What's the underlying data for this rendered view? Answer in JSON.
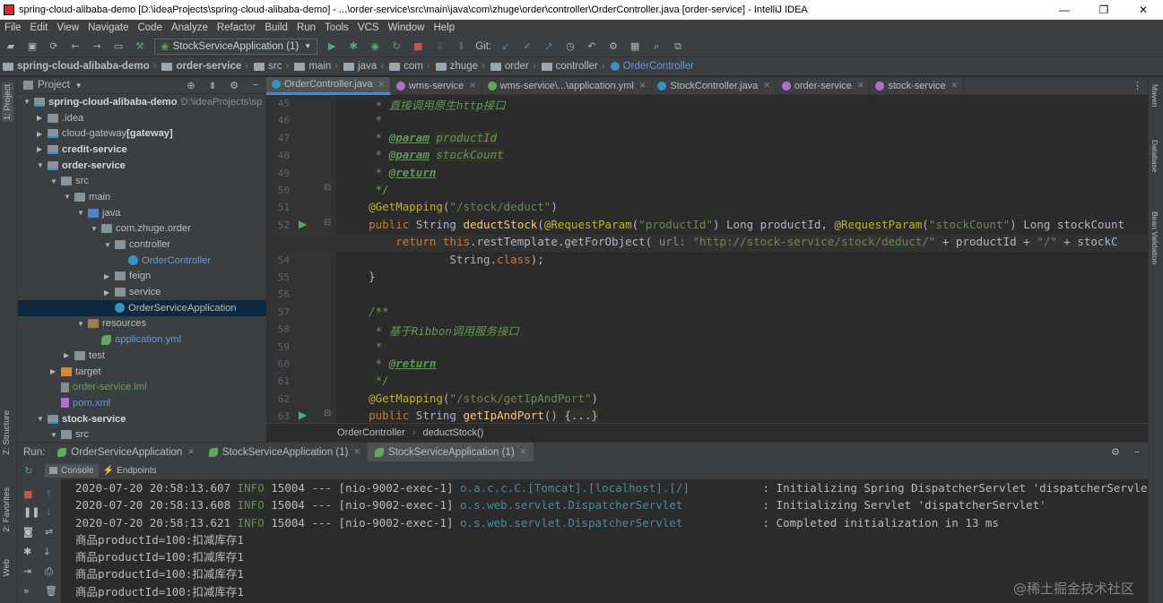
{
  "window": {
    "title": "spring-cloud-alibaba-demo [D:\\ideaProjects\\spring-cloud-alibaba-demo] - ...\\order-service\\src\\main\\java\\com\\zhuge\\order\\controller\\OrderController.java [order-service] - IntelliJ IDEA",
    "min": "—",
    "max": "❐",
    "close": "✕"
  },
  "menu": [
    "File",
    "Edit",
    "View",
    "Navigate",
    "Code",
    "Analyze",
    "Refactor",
    "Build",
    "Run",
    "Tools",
    "VCS",
    "Window",
    "Help"
  ],
  "toolbar": {
    "run_config": "StockServiceApplication (1)",
    "git_label": "Git:"
  },
  "breadcrumb": [
    "spring-cloud-alibaba-demo",
    "order-service",
    "src",
    "main",
    "java",
    "com",
    "zhuge",
    "order",
    "controller",
    "OrderController"
  ],
  "project": {
    "header": "Project",
    "tree": [
      {
        "depth": 0,
        "arrow": "▼",
        "icon": "mod",
        "text": "spring-cloud-alibaba-demo",
        "hint": "D:\\ideaProjects\\sp",
        "bold": true
      },
      {
        "depth": 1,
        "arrow": "▶",
        "icon": "fold",
        "text": ".idea"
      },
      {
        "depth": 1,
        "arrow": "▶",
        "icon": "mod",
        "text": "cloud-gateway",
        "extra": " [gateway]"
      },
      {
        "depth": 1,
        "arrow": "▶",
        "icon": "mod",
        "text": "credit-service",
        "bold": true
      },
      {
        "depth": 1,
        "arrow": "▼",
        "icon": "mod",
        "text": "order-service",
        "bold": true
      },
      {
        "depth": 2,
        "arrow": "▼",
        "icon": "fold",
        "text": "src"
      },
      {
        "depth": 3,
        "arrow": "▼",
        "icon": "fold",
        "text": "main"
      },
      {
        "depth": 4,
        "arrow": "▼",
        "icon": "src",
        "text": "java"
      },
      {
        "depth": 5,
        "arrow": "▼",
        "icon": "fold",
        "text": "com.zhuge.order"
      },
      {
        "depth": 6,
        "arrow": "▼",
        "icon": "fold",
        "text": "controller"
      },
      {
        "depth": 7,
        "arrow": "",
        "icon": "cls",
        "text": "OrderController",
        "color": "blue"
      },
      {
        "depth": 6,
        "arrow": "▶",
        "icon": "fold",
        "text": "feign"
      },
      {
        "depth": 6,
        "arrow": "▶",
        "icon": "fold",
        "text": "service"
      },
      {
        "depth": 6,
        "arrow": "",
        "icon": "cls",
        "text": "OrderServiceApplication",
        "selected": true
      },
      {
        "depth": 4,
        "arrow": "▼",
        "icon": "res",
        "text": "resources"
      },
      {
        "depth": 5,
        "arrow": "",
        "icon": "spring",
        "text": "application.yml",
        "color": "blue"
      },
      {
        "depth": 3,
        "arrow": "▶",
        "icon": "fold",
        "text": "test"
      },
      {
        "depth": 2,
        "arrow": "▶",
        "icon": "excl",
        "text": "target"
      },
      {
        "depth": 2,
        "arrow": "",
        "icon": "file",
        "text": "order-service.iml",
        "color": "green"
      },
      {
        "depth": 2,
        "arrow": "",
        "icon": "mvn",
        "text": "pom.xml",
        "color": "blue"
      },
      {
        "depth": 1,
        "arrow": "▼",
        "icon": "mod",
        "text": "stock-service",
        "bold": true
      },
      {
        "depth": 2,
        "arrow": "▼",
        "icon": "fold",
        "text": "src"
      }
    ]
  },
  "editor_tabs": [
    {
      "label": "OrderController.java",
      "active": true,
      "color": "#3592c4"
    },
    {
      "label": "wms-service",
      "color": "#b26fd0"
    },
    {
      "label": "wms-service\\...\\application.yml",
      "color": "#5fa85f"
    },
    {
      "label": "StockController.java",
      "color": "#3592c4"
    },
    {
      "label": "order-service",
      "color": "#b26fd0"
    },
    {
      "label": "stock-service",
      "color": "#b26fd0"
    }
  ],
  "code_lines": [
    {
      "n": "45",
      "html": "     <span class='cmt'>* 直接调用原生http接口</span>"
    },
    {
      "n": "46",
      "html": "     <span class='cmt'>*</span>"
    },
    {
      "n": "47",
      "html": "     <span class='cmt'>* </span><span class='tag'>@param</span><span class='cmt'> </span><span class='hl cmt'>productId</span>"
    },
    {
      "n": "48",
      "html": "     <span class='cmt'>* </span><span class='tag'>@param</span><span class='cmt'> </span><span class='hl cmt'>stockCount</span>"
    },
    {
      "n": "49",
      "html": "     <span class='cmt'>* </span><span class='tag'>@return</span>"
    },
    {
      "n": "50",
      "html": "     <span class='cmt'>*/</span>"
    },
    {
      "n": "51",
      "html": "    <span class='ann'>@GetMapping</span>(<span class='str'>\"/stock/deduct\"</span>)"
    },
    {
      "n": "52",
      "html": "    <span class='kw'>public</span> String <span class='fn'>deductStock</span>(<span class='ann'>@RequestParam</span>(<span class='str'>\"productId\"</span>) Long productId, <span class='ann'>@RequestParam</span>(<span class='str'>\"stockCount\"</span>) Long stockCount"
    },
    {
      "n": "53",
      "html": "        <span class='kw'>return this</span>.restTemplate.getForObject( <span class='param'>url:</span> <span class='str'>\"http://stock-service/stock/deduct/\"</span> + productId + <span class='str'>\"/\"</span> + stockC"
    },
    {
      "n": "54",
      "html": "                String.<span class='kw'>class</span>);"
    },
    {
      "n": "55",
      "html": "    }"
    },
    {
      "n": "56",
      "html": ""
    },
    {
      "n": "57",
      "html": "    <span class='cmt'>/**</span>"
    },
    {
      "n": "58",
      "html": "     <span class='cmt'>* 基于Ribbon调用服务接口</span>"
    },
    {
      "n": "59",
      "html": "     <span class='cmt'>*</span>"
    },
    {
      "n": "60",
      "html": "     <span class='cmt'>* </span><span class='tag'>@return</span>"
    },
    {
      "n": "61",
      "html": "     <span class='cmt'>*/</span>"
    },
    {
      "n": "62",
      "html": "    <span class='ann'>@GetMapping</span>(<span class='str'>\"/stock/getIpAndPort\"</span>)"
    },
    {
      "n": "63",
      "html": "    <span class='kw'>public</span> String <span class='fn'>getIpAndPort</span>() <span class='hl'>{...}</span>"
    }
  ],
  "editor_breadcrumb": [
    "OrderController",
    "deductStock()"
  ],
  "run": {
    "label": "Run:",
    "tabs": [
      "OrderServiceApplication",
      "StockServiceApplication (1)",
      "StockServiceApplication (1)"
    ],
    "subtabs": [
      "Console",
      "Endpoints"
    ],
    "console": [
      {
        "ts": "2020-07-20 20:58:13.607",
        "lvl": "INFO",
        "pid": "15004",
        "sep": "---",
        "thread": "[nio-9002-exec-1]",
        "logger": "o.a.c.c.C.[Tomcat].[localhost].[/]",
        "msg": ": Initializing Spring DispatcherServlet 'dispatcherServlet'"
      },
      {
        "ts": "2020-07-20 20:58:13.608",
        "lvl": "INFO",
        "pid": "15004",
        "sep": "---",
        "thread": "[nio-9002-exec-1]",
        "logger": "o.s.web.servlet.DispatcherServlet",
        "msg": ": Initializing Servlet 'dispatcherServlet'"
      },
      {
        "ts": "2020-07-20 20:58:13.621",
        "lvl": "INFO",
        "pid": "15004",
        "sep": "---",
        "thread": "[nio-9002-exec-1]",
        "logger": "o.s.web.servlet.DispatcherServlet",
        "msg": ": Completed initialization in 13 ms"
      }
    ],
    "plain_lines": [
      "商品productId=100:扣减库存1",
      "商品productId=100:扣减库存1",
      "商品productId=100:扣减库存1",
      "商品productId=100:扣减库存1"
    ]
  },
  "side_tabs": {
    "left": [
      "1: Project",
      "Z: Structure",
      "2: Favorites",
      "Web"
    ],
    "right": [
      "Maven",
      "Database",
      "Bean Validation"
    ]
  },
  "watermark": "@稀土掘金技术社区"
}
